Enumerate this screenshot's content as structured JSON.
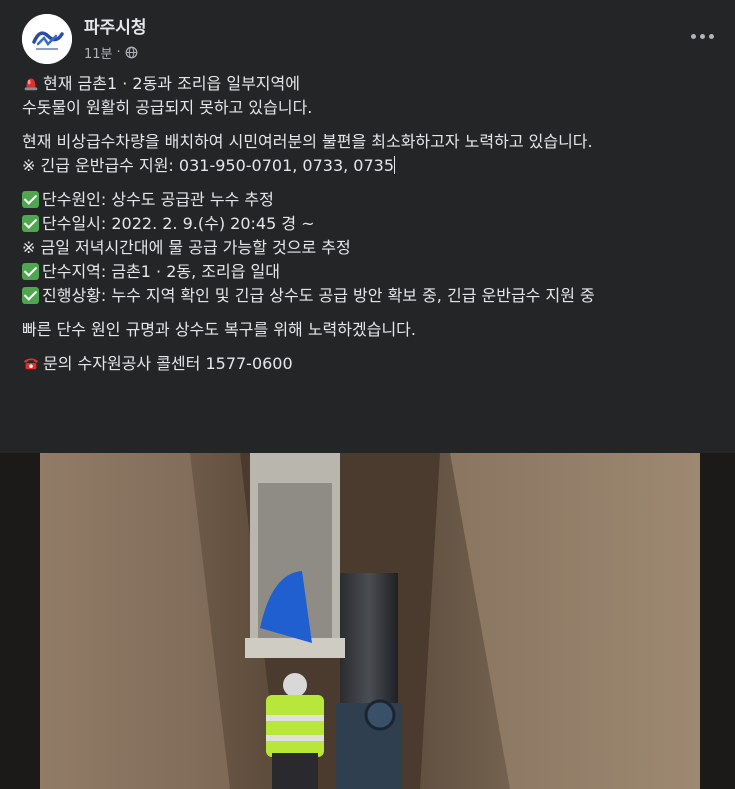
{
  "post": {
    "page_name": "파주시청",
    "time": "11분",
    "separator": "·",
    "lines": {
      "l1": "현재 금촌1 · 2동과 조리읍 일부지역에",
      "l2": "수돗물이 원활히 공급되지 못하고 있습니다.",
      "l3": "현재 비상급수차량을 배치하여 시민여러분의 불편을 최소화하고자 노력하고 있습니다.",
      "l4": "※ 긴급 운반급수 지원: 031-950-0701, 0733, 0735",
      "l5": "단수원인: 상수도 공급관 누수 추정",
      "l6": "단수일시: 2022. 2. 9.(수) 20:45 경 ~",
      "l7": "※ 금일 저녁시간대에 물 공급 가능할 것으로 추정",
      "l8": "단수지역: 금촌1 · 2동, 조리읍 일대",
      "l9": "진행상황: 누수 지역 확인 및 긴급 상수도 공급 방안 확보 중, 긴급 운반급수 지원 중",
      "l10": "빠른 단수 원인 규명과 상수도 복구를 위해 노력하겠습니다.",
      "l11": "문의 수자원공사 콜센터 1577-0600"
    },
    "icons": {
      "siren": "police-car-light-icon",
      "check": "check-mark-button-icon",
      "phone": "telephone-icon",
      "globe": "globe-icon",
      "more": "more-options-icon"
    },
    "colors": {
      "background": "#242526",
      "text": "#e4e6eb",
      "muted": "#b0b3b8",
      "check": "#4ea64e"
    }
  }
}
